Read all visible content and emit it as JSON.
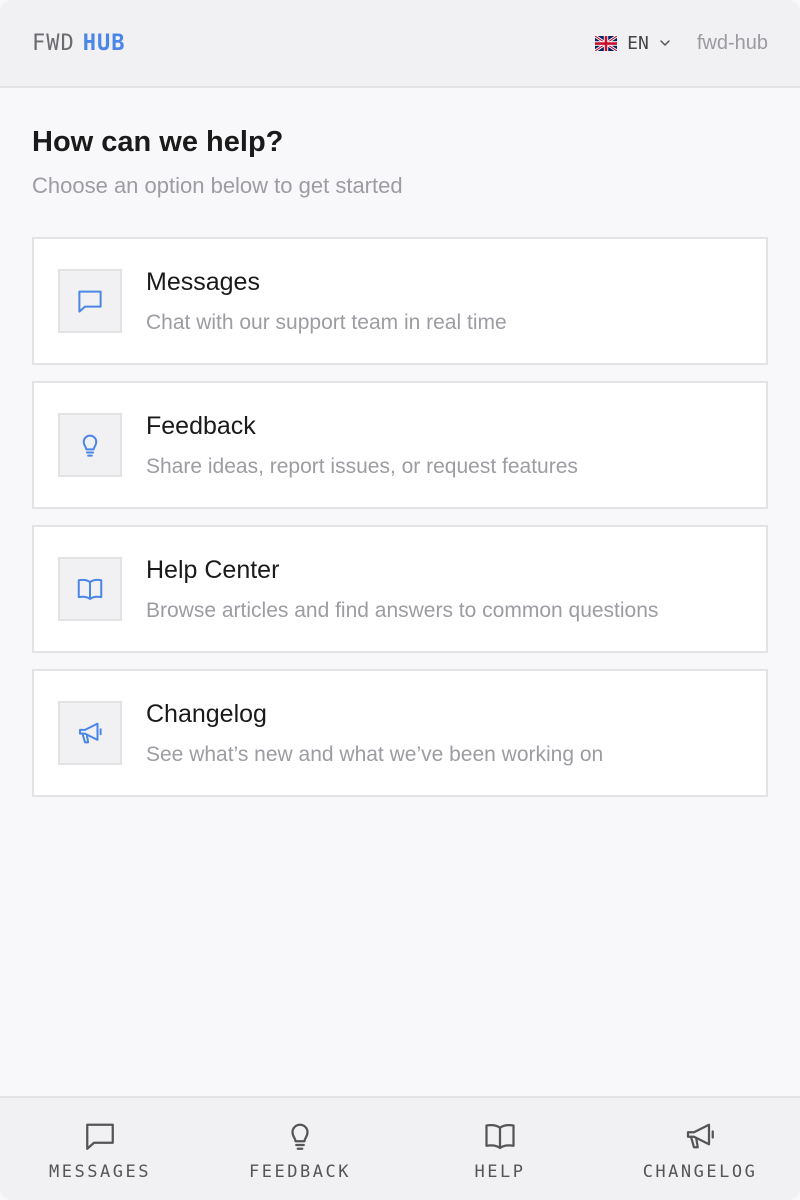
{
  "header": {
    "logo_prefix": "FWD",
    "logo_suffix": "HUB",
    "language": "EN",
    "language_flag_icon": "uk-flag-icon",
    "account_name": "fwd-hub"
  },
  "main": {
    "title": "How can we help?",
    "subtitle": "Choose an option below to get started",
    "cards": [
      {
        "title": "Messages",
        "description": "Chat with our support team in real time",
        "icon": "chat-bubble-icon"
      },
      {
        "title": "Feedback",
        "description": "Share ideas, report issues, or request features",
        "icon": "lightbulb-icon"
      },
      {
        "title": "Help Center",
        "description": "Browse articles and find answers to common questions",
        "icon": "book-icon"
      },
      {
        "title": "Changelog",
        "description": "See what’s new and what we’ve been working on",
        "icon": "megaphone-icon"
      }
    ]
  },
  "nav": {
    "items": [
      {
        "label": "MESSAGES",
        "icon": "chat-bubble-icon"
      },
      {
        "label": "FEEDBACK",
        "icon": "lightbulb-icon"
      },
      {
        "label": "HELP",
        "icon": "book-icon"
      },
      {
        "label": "CHANGELOG",
        "icon": "megaphone-icon"
      }
    ]
  },
  "colors": {
    "accent": "#4a86e8",
    "background": "#f8f8fa",
    "header": "#f1f1f3",
    "border": "#e3e3e6",
    "muted_text": "#9c9ca2"
  }
}
